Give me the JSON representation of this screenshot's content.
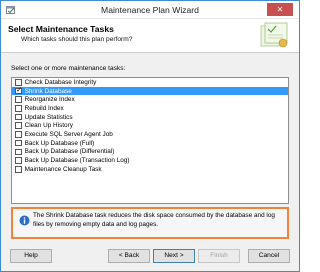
{
  "window": {
    "title": "Maintenance Plan Wizard",
    "close_glyph": "✕"
  },
  "header": {
    "title": "Select Maintenance Tasks",
    "subtitle": "Which tasks should this plan perform?"
  },
  "task_list": {
    "label": "Select one or more maintenance tasks:",
    "items": [
      {
        "label": "Check Database Integrity",
        "checked": false,
        "selected": false
      },
      {
        "label": "Shrink Database",
        "checked": true,
        "selected": true
      },
      {
        "label": "Reorganize Index",
        "checked": false,
        "selected": false
      },
      {
        "label": "Rebuild Index",
        "checked": false,
        "selected": false
      },
      {
        "label": "Update Statistics",
        "checked": false,
        "selected": false
      },
      {
        "label": "Clean Up History",
        "checked": false,
        "selected": false
      },
      {
        "label": "Execute SQL Server Agent Job",
        "checked": false,
        "selected": false
      },
      {
        "label": "Back Up Database (Full)",
        "checked": false,
        "selected": false
      },
      {
        "label": "Back Up Database (Differential)",
        "checked": false,
        "selected": false
      },
      {
        "label": "Back Up Database (Transaction Log)",
        "checked": false,
        "selected": false
      },
      {
        "label": "Maintenance Cleanup Task",
        "checked": false,
        "selected": false
      }
    ]
  },
  "info": {
    "icon": "info-icon",
    "text": "The Shrink Database task reduces the disk space consumed by the database and log files by removing empty data and log pages."
  },
  "buttons": {
    "help": "Help",
    "back": "< Back",
    "next": "Next >",
    "finish": "Finish",
    "cancel": "Cancel"
  },
  "colors": {
    "selection": "#3399ff",
    "info_border": "#f5823a",
    "close": "#c75050"
  }
}
